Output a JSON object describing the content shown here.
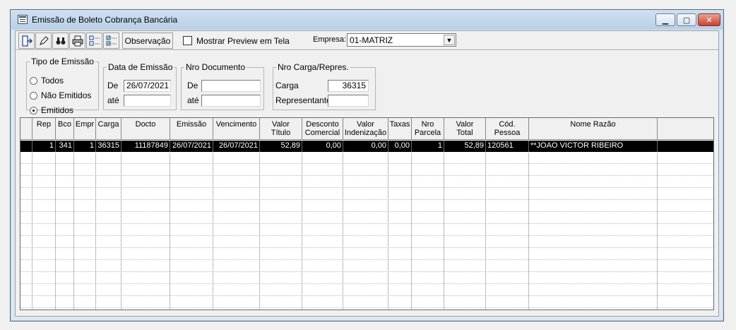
{
  "window": {
    "title": "Emissão de Boleto Cobrança Bancária",
    "minimize_label": "▁",
    "maximize_label": "▢",
    "close_label": "✕"
  },
  "toolbar": {
    "exit_icon": "exit-door-icon",
    "edit_icon": "pencil-icon",
    "search_icon": "binoculars-icon",
    "print_icon": "printer-icon",
    "uncheck_icon": "unchecked-list-icon",
    "check_icon": "checked-list-icon",
    "observacao_label": "Observação",
    "preview_label": "Mostrar Preview em Tela",
    "empresa_label": "Empresa:",
    "empresa_value": "01-MATRIZ"
  },
  "filters": {
    "tipo": {
      "legend": "Tipo de Emissão",
      "options": [
        "Todos",
        "Não Emitidos",
        "Emitidos"
      ],
      "selected": "Emitidos"
    },
    "data": {
      "legend": "Data de Emissão",
      "de_label": "De",
      "ate_label": "até",
      "de_value": "26/07/2021",
      "ate_value": ""
    },
    "nro": {
      "legend": "Nro Documento",
      "de_label": "De",
      "ate_label": "até",
      "de_value": "",
      "ate_value": ""
    },
    "carga": {
      "legend": "Nro Carga/Repres.",
      "carga_label": "Carga",
      "carga_value": "36315",
      "rep_label": "Representante",
      "rep_value": ""
    }
  },
  "grid": {
    "headers": [
      "Rep",
      "Bco",
      "Empr",
      "Carga",
      "Docto",
      "Emissão",
      "Vencimento",
      "Valor\nTítulo",
      "Desconto\nComercial",
      "Valor\nIndenização",
      "Taxas",
      "Nro\nParcela",
      "Valor\nTotal",
      "Cód.\nPessoa",
      "Nome Razão"
    ],
    "rows": [
      [
        "1",
        "341",
        "1",
        "36315",
        "11187849",
        "26/07/2021",
        "26/07/2021",
        "52,89",
        "0,00",
        "0,00",
        "0,00",
        "1",
        "52,89",
        "120561",
        "**JOAO VICTOR RIBEIRO"
      ]
    ]
  }
}
